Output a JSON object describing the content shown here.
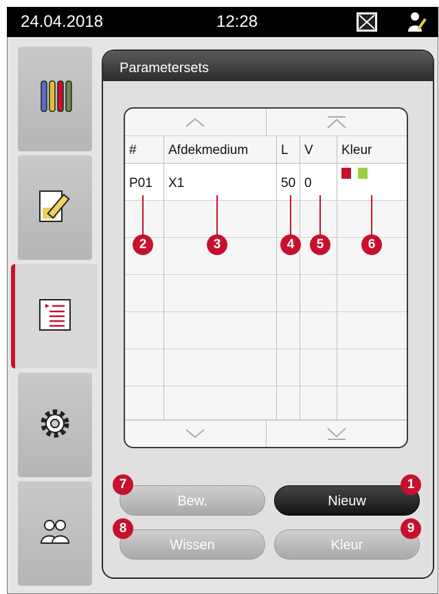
{
  "status": {
    "date": "24.04.2018",
    "time": "12:28",
    "alarm_icon": "alarm-muted-icon",
    "user_icon": "user-edit-icon"
  },
  "sidebar": {
    "tabs": [
      {
        "icon": "reagent-bottles-icon",
        "active": false
      },
      {
        "icon": "slide-edit-icon",
        "active": false
      },
      {
        "icon": "parameter-list-icon",
        "active": true
      },
      {
        "icon": "gear-icon",
        "active": false
      },
      {
        "icon": "users-icon",
        "active": false
      }
    ]
  },
  "panel": {
    "title": "Parametersets",
    "table": {
      "columns": [
        "#",
        "Afdekmedium",
        "L",
        "V",
        "Kleur"
      ],
      "rows": [
        {
          "id": "P01",
          "medium": "X1",
          "l": "50",
          "v": "0",
          "colors": [
            "#c8102e",
            "#9ad13c"
          ]
        }
      ],
      "empty_rows": 6
    },
    "buttons": {
      "edit": "Bew.",
      "new": "Nieuw",
      "delete": "Wissen",
      "color": "Kleur"
    }
  },
  "callouts": [
    "1",
    "2",
    "3",
    "4",
    "5",
    "6",
    "7",
    "8",
    "9"
  ],
  "colors": {
    "accent": "#c8102e",
    "green": "#9ad13c"
  }
}
